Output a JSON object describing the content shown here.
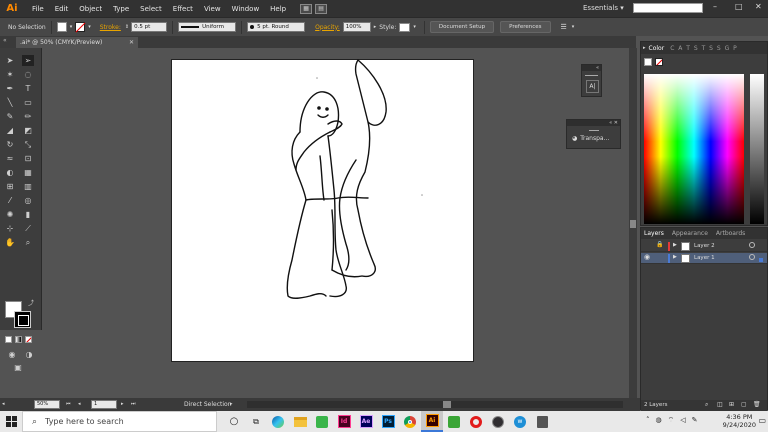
{
  "app": {
    "logo": "Ai"
  },
  "menu": [
    "File",
    "Edit",
    "Object",
    "Type",
    "Select",
    "Effect",
    "View",
    "Window",
    "Help"
  ],
  "workspace": {
    "label": "Essentials"
  },
  "controlbar": {
    "selection_label": "No Selection",
    "stroke_label": "Stroke:",
    "stroke_weight": "0.5 pt",
    "profile": "Uniform",
    "brush": "5 pt. Round",
    "opacity_label": "Opacity:",
    "opacity_value": "100%",
    "style_label": "Style:",
    "doc_setup": "Document Setup",
    "preferences": "Preferences"
  },
  "document_tab": {
    "title": ".ai* @ 50% (CMYK/Preview)"
  },
  "panels": {
    "char_glyph": "A|",
    "transparency_label": "Transpa...",
    "color_tab": "Color",
    "color_letters": "C A T S T S S G P",
    "layers_tabs": [
      "Layers",
      "Appearance",
      "Artboards"
    ],
    "layers": [
      {
        "name": "Layer 2",
        "color": "#e23a3a"
      },
      {
        "name": "Layer 1",
        "color": "#4a7bd6"
      }
    ],
    "layers_count": "2 Layers"
  },
  "statusbar": {
    "zoom": "50%",
    "page": "1",
    "tool": "Direct Selection"
  },
  "taskbar": {
    "search_placeholder": "Type here to search",
    "time": "4:36 PM",
    "date": "9/24/2020",
    "apps": [
      {
        "label": "Id",
        "bg": "#49021f",
        "fg": "#ff3d93"
      },
      {
        "label": "Ae",
        "bg": "#00005b",
        "fg": "#d8a1ff"
      },
      {
        "label": "Ps",
        "bg": "#001e36",
        "fg": "#31a8ff"
      },
      {
        "label": "Ai",
        "bg": "#330000",
        "fg": "#ff9a00"
      }
    ]
  }
}
